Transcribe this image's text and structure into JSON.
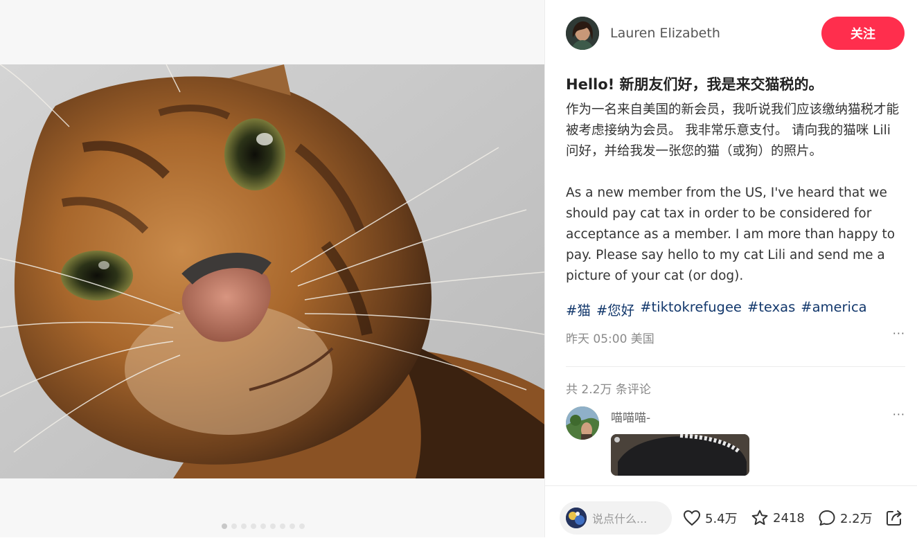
{
  "author": {
    "name": "Lauren Elizabeth",
    "follow_label": "关注"
  },
  "post": {
    "title": "Hello! 新朋友们好，我是来交猫税的。",
    "desc_zh": "作为一名来自美国的新会员，我听说我们应该缴纳猫税才能被考虑接纳为会员。 我非常乐意支付。 请向我的猫咪 Lili 问好，并给我发一张您的猫（或狗）的照片。",
    "desc_en": "As a new member from the US, I've heard that we should pay cat tax in order to be considered for acceptance as a member. I am more than happy to pay. Please say hello to my cat Lili and send me a picture of your cat (or dog).",
    "tags": [
      "#猫",
      "#您好",
      "#tiktokrefugee",
      "#texas",
      "#america"
    ],
    "meta": "昨天 05:00 美国",
    "more": "···"
  },
  "comments": {
    "count_label": "共 2.2万 条评论",
    "items": [
      {
        "name": "喵喵喵-",
        "more": "···"
      }
    ]
  },
  "bottom": {
    "placeholder": "说点什么...",
    "likes": "5.4万",
    "collects": "2418",
    "comments": "2.2万"
  },
  "carousel": {
    "total": 9,
    "active": 0
  }
}
